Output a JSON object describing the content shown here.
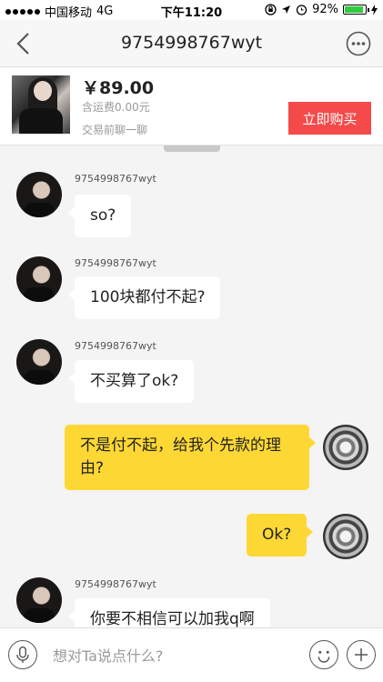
{
  "status_bar": {
    "carrier": "中国移动",
    "network": "4G",
    "time": "下午11:20",
    "battery": "92%",
    "battery_level": 0.92
  },
  "nav": {
    "title": "9754998767wyt",
    "back_icon": "chevron-left-icon",
    "more_icon": "ellipsis-circle-icon"
  },
  "product": {
    "price": "￥89.00",
    "shipping": "含运费0.00元",
    "chat_note": "交易前聊一聊",
    "buy_label": "立即购买",
    "buy_color": "#f44a4a"
  },
  "messages": [
    {
      "side": "left",
      "sender": "9754998767wyt",
      "text": "so?"
    },
    {
      "side": "left",
      "sender": "9754998767wyt",
      "text": "100块都付不起?"
    },
    {
      "side": "left",
      "sender": "9754998767wyt",
      "text": "不买算了ok?"
    },
    {
      "side": "right",
      "text": "不是付不起，给我个先款的理由?"
    },
    {
      "side": "right",
      "text": "Ok?"
    },
    {
      "side": "left",
      "sender": "9754998767wyt",
      "text": "你要不相信可以加我q啊"
    }
  ],
  "input_bar": {
    "placeholder": "想对Ta说点什么?",
    "accent_bubble_color": "#fdd835"
  }
}
